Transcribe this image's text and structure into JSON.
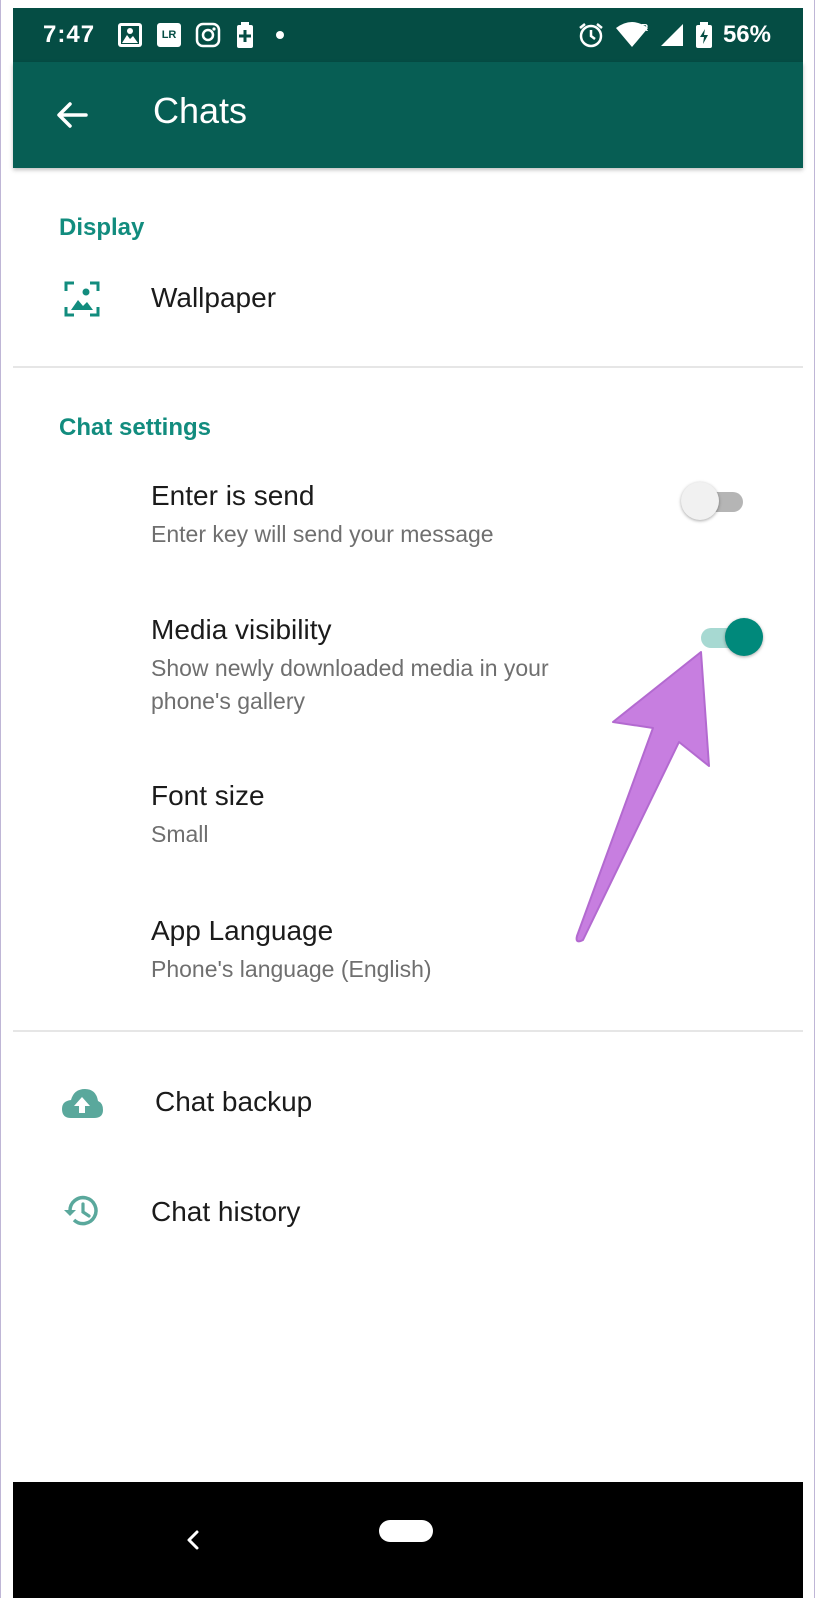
{
  "status_bar": {
    "time": "7:47",
    "battery": "56%",
    "left_icons": [
      "gallery-icon",
      "lightroom-icon",
      "instagram-icon",
      "battery-saver-icon",
      "dot-icon"
    ],
    "right_icons": [
      "alarm-icon",
      "wifi-icon",
      "signal-icon",
      "battery-icon"
    ],
    "lightroom_text": "LR"
  },
  "app_bar": {
    "title": "Chats",
    "back_icon": "arrow-back-icon"
  },
  "sections": {
    "display": {
      "header": "Display",
      "wallpaper": {
        "title": "Wallpaper",
        "icon": "wallpaper-icon"
      }
    },
    "chat_settings": {
      "header": "Chat settings",
      "enter_is_send": {
        "title": "Enter is send",
        "subtitle": "Enter key will send your message",
        "enabled": false
      },
      "media_visibility": {
        "title": "Media visibility",
        "subtitle": "Show newly downloaded media in your phone's gallery",
        "enabled": true
      },
      "font_size": {
        "title": "Font size",
        "subtitle": "Small"
      },
      "app_language": {
        "title": "App Language",
        "subtitle": "Phone's language (English)"
      }
    },
    "other": {
      "chat_backup": {
        "title": "Chat backup",
        "icon": "cloud-upload-icon"
      },
      "chat_history": {
        "title": "Chat history",
        "icon": "history-icon"
      }
    }
  },
  "colors": {
    "status_bar": "#054d44",
    "app_bar": "#075e54",
    "accent": "#128c7e",
    "toggle_on": "#00897b",
    "arrow": "#c77ee0"
  },
  "nav_bar": {
    "icons": [
      "nav-back-icon",
      "nav-home-pill"
    ]
  }
}
